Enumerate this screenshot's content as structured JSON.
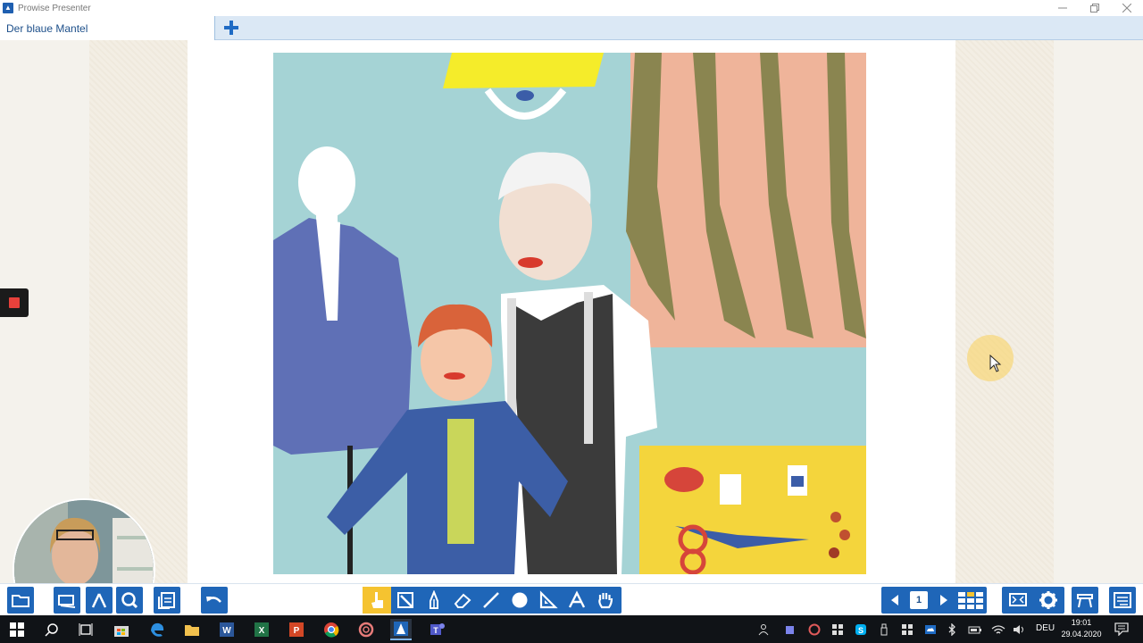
{
  "window": {
    "title": "Prowise Presenter"
  },
  "tabs": [
    {
      "label": "Der blaue Mantel"
    }
  ],
  "toolbar": {
    "current_page": "1",
    "active_tool": "hand-pointer"
  },
  "taskbar": {
    "language": "DEU",
    "time": "19:01",
    "date": "29.04.2020"
  },
  "colors": {
    "accent": "#1f66b8",
    "active_tool": "#f5c330",
    "tab_bar": "#dbe8f5",
    "record": "#e8413b"
  }
}
